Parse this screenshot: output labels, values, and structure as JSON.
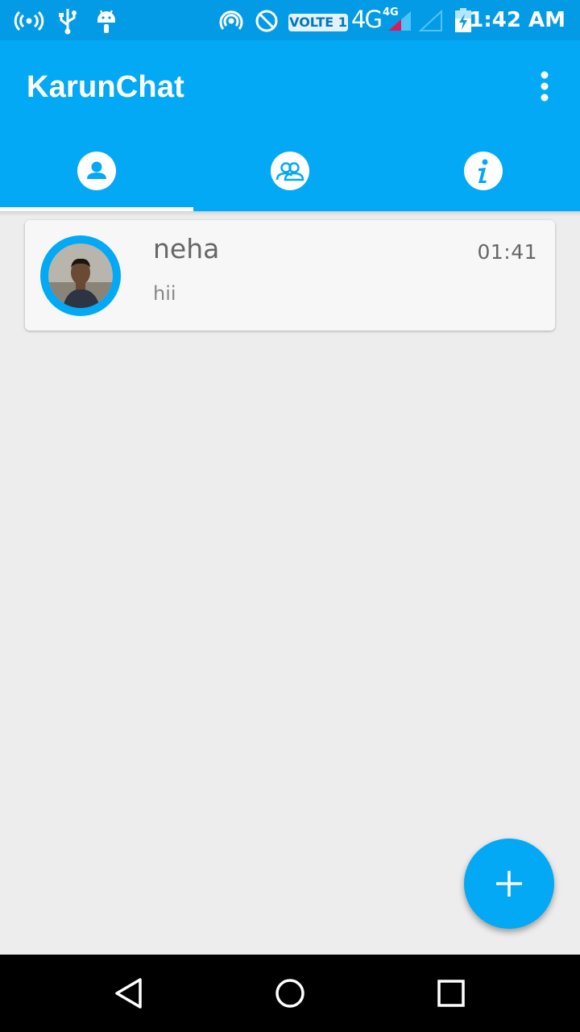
{
  "status_bar": {
    "volte_label": "VOLTE 1",
    "network_label": "4G",
    "network_sup_label": "4G",
    "time": "1:42 AM",
    "icons": [
      "wireless-broadcast-icon",
      "usb-icon",
      "android-icon",
      "hotspot-icon",
      "do-not-disturb-icon",
      "signal-icon",
      "battery-charging-icon"
    ]
  },
  "app_bar": {
    "title": "KarunChat",
    "menu_icon": "overflow-menu-icon",
    "background_color": "#03a9f4"
  },
  "tabs": [
    {
      "icon": "person-icon",
      "selected": true
    },
    {
      "icon": "group-icon",
      "selected": false
    },
    {
      "icon": "info-icon",
      "selected": false
    }
  ],
  "chats": [
    {
      "name": "neha",
      "last_message": "hii",
      "time": "01:41",
      "avatar": "avatar-photo"
    }
  ],
  "fab": {
    "icon": "plus-icon",
    "color": "#03a9f4"
  },
  "nav_bar": {
    "icons": [
      "back-icon",
      "home-icon",
      "recents-icon"
    ]
  }
}
